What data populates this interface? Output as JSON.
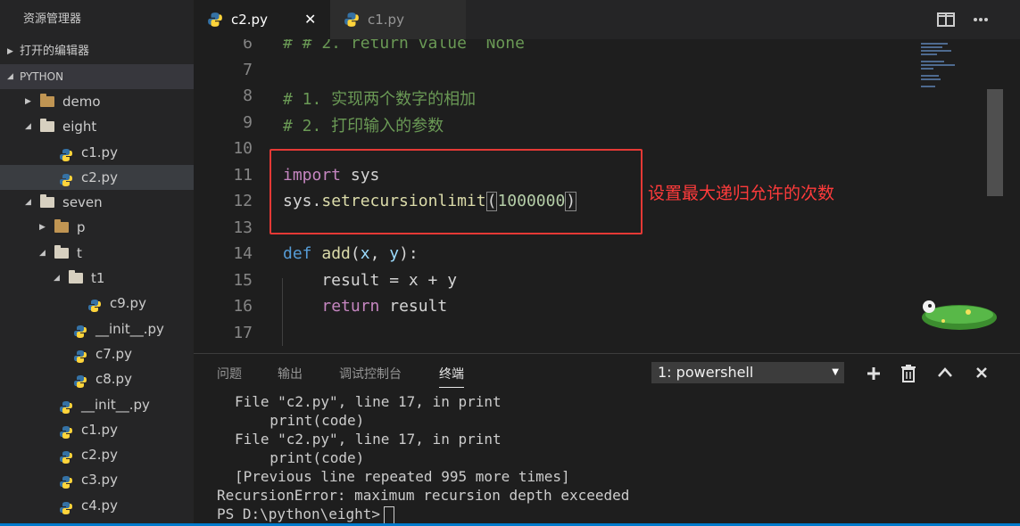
{
  "sidebar": {
    "title": "资源管理器",
    "open_editors": "打开的编辑器",
    "root": "PYTHON",
    "tree": [
      {
        "label": "demo",
        "type": "folder",
        "depth": 1,
        "expanded": false
      },
      {
        "label": "eight",
        "type": "folder",
        "depth": 1,
        "expanded": true
      },
      {
        "label": "c1.py",
        "type": "py",
        "depth": 2
      },
      {
        "label": "c2.py",
        "type": "py",
        "depth": 2,
        "selected": true
      },
      {
        "label": "seven",
        "type": "folder",
        "depth": 1,
        "expanded": true
      },
      {
        "label": "p",
        "type": "folder",
        "depth": 2,
        "expanded": false
      },
      {
        "label": "t",
        "type": "folder",
        "depth": 2,
        "expanded": true
      },
      {
        "label": "t1",
        "type": "folder",
        "depth": 3,
        "expanded": true
      },
      {
        "label": "c9.py",
        "type": "py",
        "depth": 4
      },
      {
        "label": "__init__.py",
        "type": "py",
        "depth": 3
      },
      {
        "label": "c7.py",
        "type": "py",
        "depth": 3
      },
      {
        "label": "c8.py",
        "type": "py",
        "depth": 3
      },
      {
        "label": "__init__.py",
        "type": "py",
        "depth": 2
      },
      {
        "label": "c1.py",
        "type": "py",
        "depth": 2
      },
      {
        "label": "c2.py",
        "type": "py",
        "depth": 2
      },
      {
        "label": "c3.py",
        "type": "py",
        "depth": 2
      },
      {
        "label": "c4.py",
        "type": "py",
        "depth": 2
      }
    ]
  },
  "tabs": [
    {
      "label": "c2.py",
      "active": true,
      "close": "✕"
    },
    {
      "label": "c1.py",
      "active": false
    }
  ],
  "editor": {
    "lines": [
      {
        "num": "6",
        "text": "# # 2. return value  None"
      },
      {
        "num": "7",
        "text": ""
      },
      {
        "num": "8",
        "text": "# 1. 实现两个数字的相加"
      },
      {
        "num": "9",
        "text": "# 2. 打印输入的参数"
      },
      {
        "num": "10",
        "text": ""
      },
      {
        "num": "11",
        "text": "import sys"
      },
      {
        "num": "12",
        "text": "sys.setrecursionlimit(1000000)"
      },
      {
        "num": "13",
        "text": ""
      },
      {
        "num": "14",
        "text": "def add(x, y):"
      },
      {
        "num": "15",
        "text": "    result = x + y"
      },
      {
        "num": "16",
        "text": "    return result"
      },
      {
        "num": "17",
        "text": ""
      }
    ],
    "annotation": "设置最大递归允许的次数",
    "tokens": {
      "l6": "# # 2. return value  None",
      "l8": "# 1. 实现两个数字的相加",
      "l9": "# 2. 打印输入的参数",
      "import_kw": "import",
      "sys": " sys",
      "sys2": "sys.",
      "setrec": "setrecursionlimit",
      "paren_open": "(",
      "num": "1000000",
      "paren_close": ")",
      "def_kw": "def",
      "add_fn": " add",
      "add_args_open": "(",
      "x": "x",
      "comma": ", ",
      "y": "y",
      "add_args_close": "):",
      "result_line": "    result = x + y",
      "return_kw": "return",
      "return_rest": " result",
      "indent": "    "
    }
  },
  "panel": {
    "tabs": [
      "问题",
      "输出",
      "调试控制台",
      "终端"
    ],
    "active_tab": "终端",
    "terminal_select": "1: powershell",
    "terminal_lines": [
      "File \"c2.py\", line 17, in print",
      "  print(code)",
      "File \"c2.py\", line 17, in print",
      "  print(code)",
      "[Previous line repeated 995 more times]",
      "RecursionError: maximum recursion depth exceeded",
      "PS D:\\python\\eight>"
    ]
  },
  "colors": {
    "accent": "#007acc",
    "annotation_red": "#e53935",
    "python_blue": "#3572a5",
    "python_yellow": "#ffd43b"
  }
}
